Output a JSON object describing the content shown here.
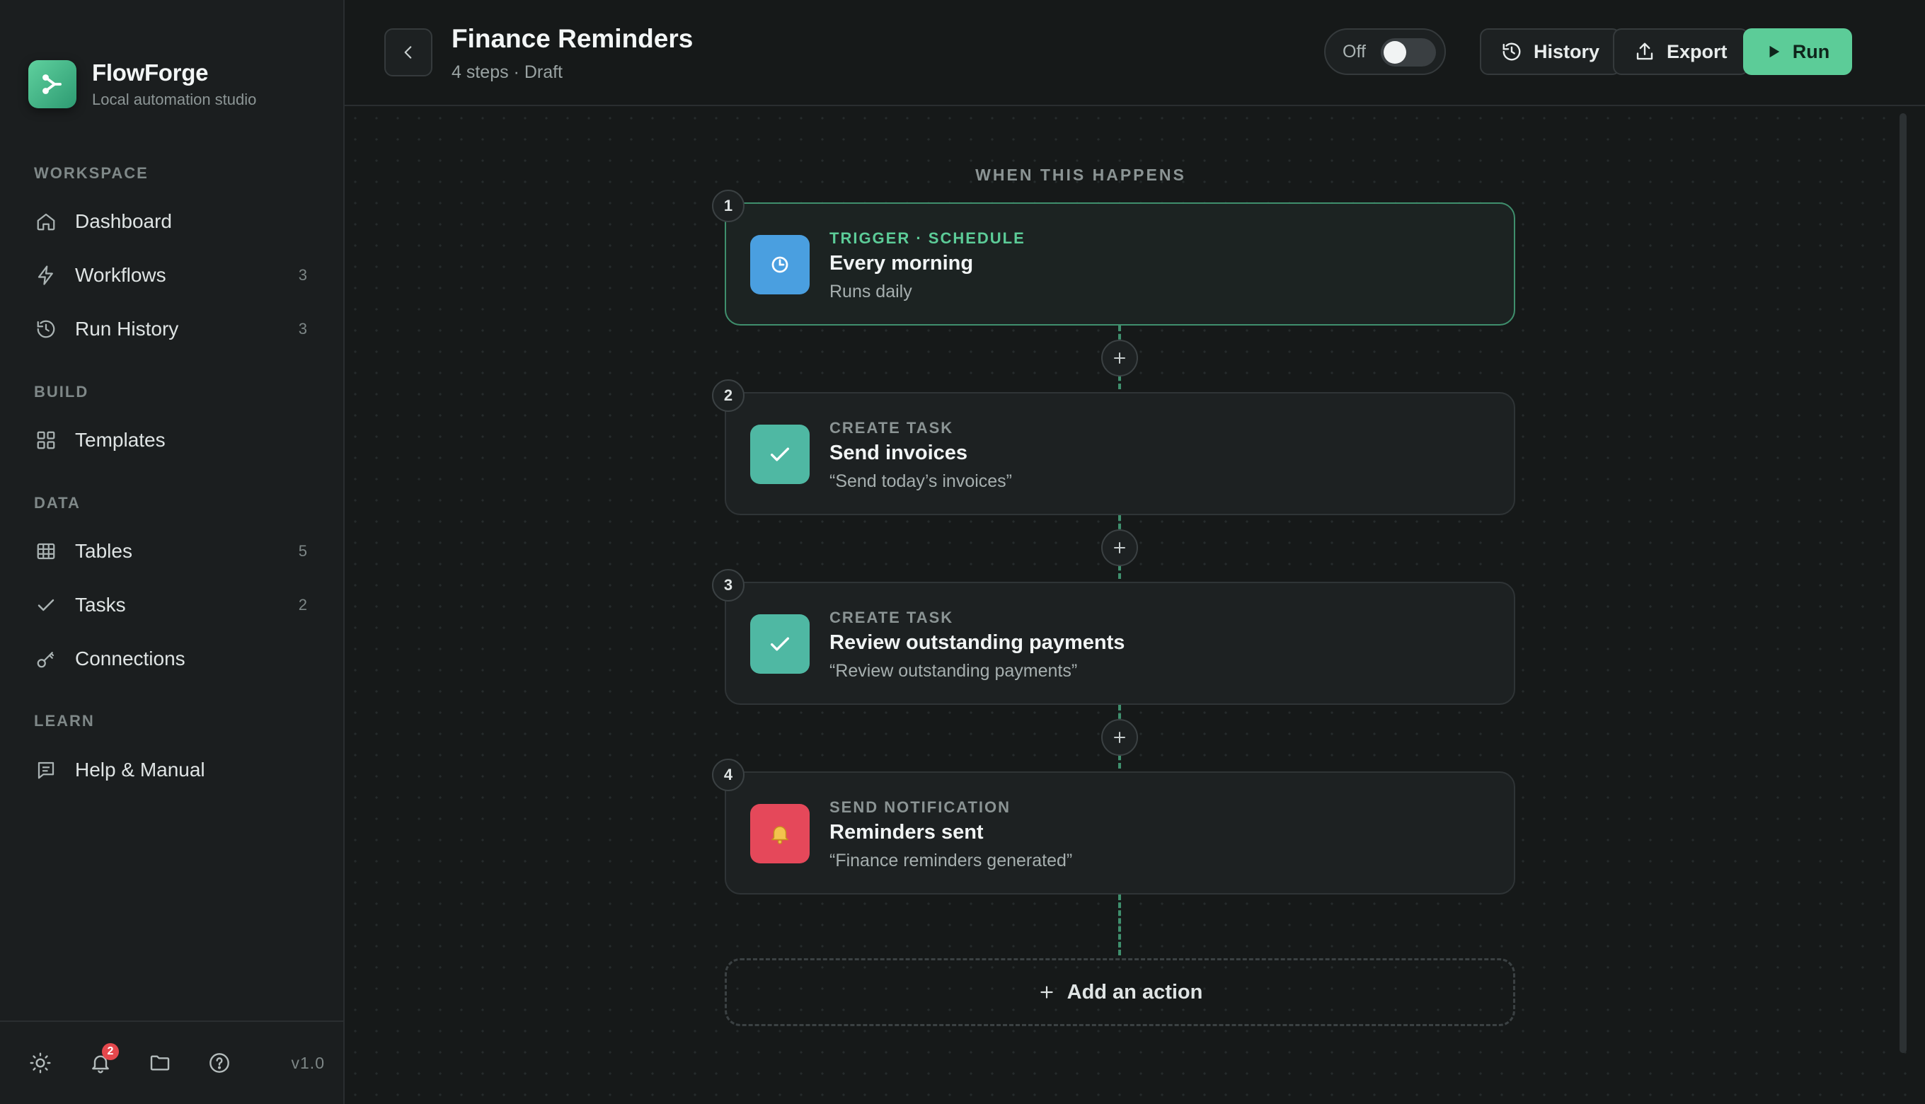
{
  "brand": {
    "name": "FlowForge",
    "subtitle": "Local automation studio"
  },
  "sidebar": {
    "sections": [
      {
        "label": "WORKSPACE"
      },
      {
        "label": "BUILD"
      },
      {
        "label": "DATA"
      },
      {
        "label": "LEARN"
      }
    ],
    "items": [
      {
        "label": "Dashboard",
        "icon": "home-icon",
        "count": ""
      },
      {
        "label": "Workflows",
        "icon": "bolt-icon",
        "count": "3"
      },
      {
        "label": "Run History",
        "icon": "history-icon",
        "count": "3"
      },
      {
        "label": "Templates",
        "icon": "grid-icon",
        "count": ""
      },
      {
        "label": "Tables",
        "icon": "table-icon",
        "count": "5"
      },
      {
        "label": "Tasks",
        "icon": "check-icon",
        "count": "2"
      },
      {
        "label": "Connections",
        "icon": "key-icon",
        "count": ""
      },
      {
        "label": "Help & Manual",
        "icon": "manual-icon",
        "count": ""
      }
    ],
    "footer": {
      "notifications_count": "2",
      "version": "v1.0"
    }
  },
  "header": {
    "title": "Finance Reminders",
    "subtitle": "4 steps · Draft",
    "toggle_label": "Off",
    "history_label": "History",
    "export_label": "Export",
    "run_label": "Run"
  },
  "canvas": {
    "when_label": "WHEN THIS HAPPENS",
    "steps": [
      {
        "number": "1",
        "type": "TRIGGER · SCHEDULE",
        "title": "Every morning",
        "description": "Runs daily",
        "icon": "clock-icon",
        "color": "#4a9fe0"
      },
      {
        "number": "2",
        "type": "CREATE TASK",
        "title": "Send invoices",
        "description": "“Send today’s invoices”",
        "icon": "check-icon",
        "color": "#4fb8a3"
      },
      {
        "number": "3",
        "type": "CREATE TASK",
        "title": "Review outstanding payments",
        "description": "“Review outstanding payments”",
        "icon": "check-icon",
        "color": "#4fb8a3"
      },
      {
        "number": "4",
        "type": "SEND NOTIFICATION",
        "title": "Reminders sent",
        "description": "“Finance reminders generated”",
        "icon": "bell-icon",
        "color": "#e5485a"
      }
    ],
    "add_action_label": "Add an action"
  },
  "colors": {
    "accent": "#5ccc98",
    "background": "#161919",
    "sidebar": "#1b1e1f"
  }
}
